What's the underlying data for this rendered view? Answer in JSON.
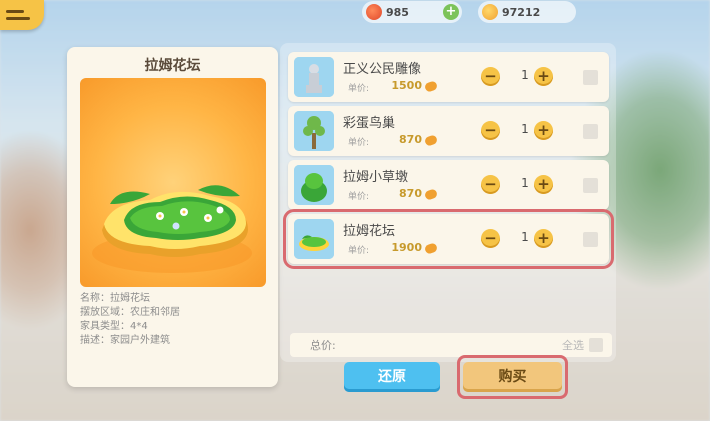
{
  "currency": [
    {
      "icon": "heart-coin-icon",
      "value": "985"
    },
    {
      "icon": "coin-icon",
      "value": "97212"
    }
  ],
  "detail": {
    "title": "拉姆花坛",
    "info": [
      "名称：拉姆花坛",
      "摆放区域：农庄和邻居",
      "家具类型：4*4",
      "描述：家园户外建筑"
    ]
  },
  "items": [
    {
      "name": "正义公民雕像",
      "price_label": "单价:",
      "price": "1500",
      "qty": "1",
      "icon": "statue-icon",
      "selected": false
    },
    {
      "name": "彩蛋鸟巢",
      "price_label": "单价:",
      "price": "870",
      "qty": "1",
      "icon": "nest-tree-icon",
      "selected": false
    },
    {
      "name": "拉姆小草墩",
      "price_label": "单价:",
      "price": "870",
      "qty": "1",
      "icon": "grass-stool-icon",
      "selected": false
    },
    {
      "name": "拉姆花坛",
      "price_label": "单价:",
      "price": "1900",
      "qty": "1",
      "icon": "flower-bed-icon",
      "selected": true
    }
  ],
  "footer": {
    "total_label": "总价:",
    "select_all_label": "全选",
    "reset_label": "还原",
    "buy_label": "购买"
  },
  "colors": {
    "accent_yellow": "#f6c346",
    "reset_blue": "#4ec0f0",
    "highlight_red": "#d96a6f",
    "price_gold": "#c79a2c"
  }
}
